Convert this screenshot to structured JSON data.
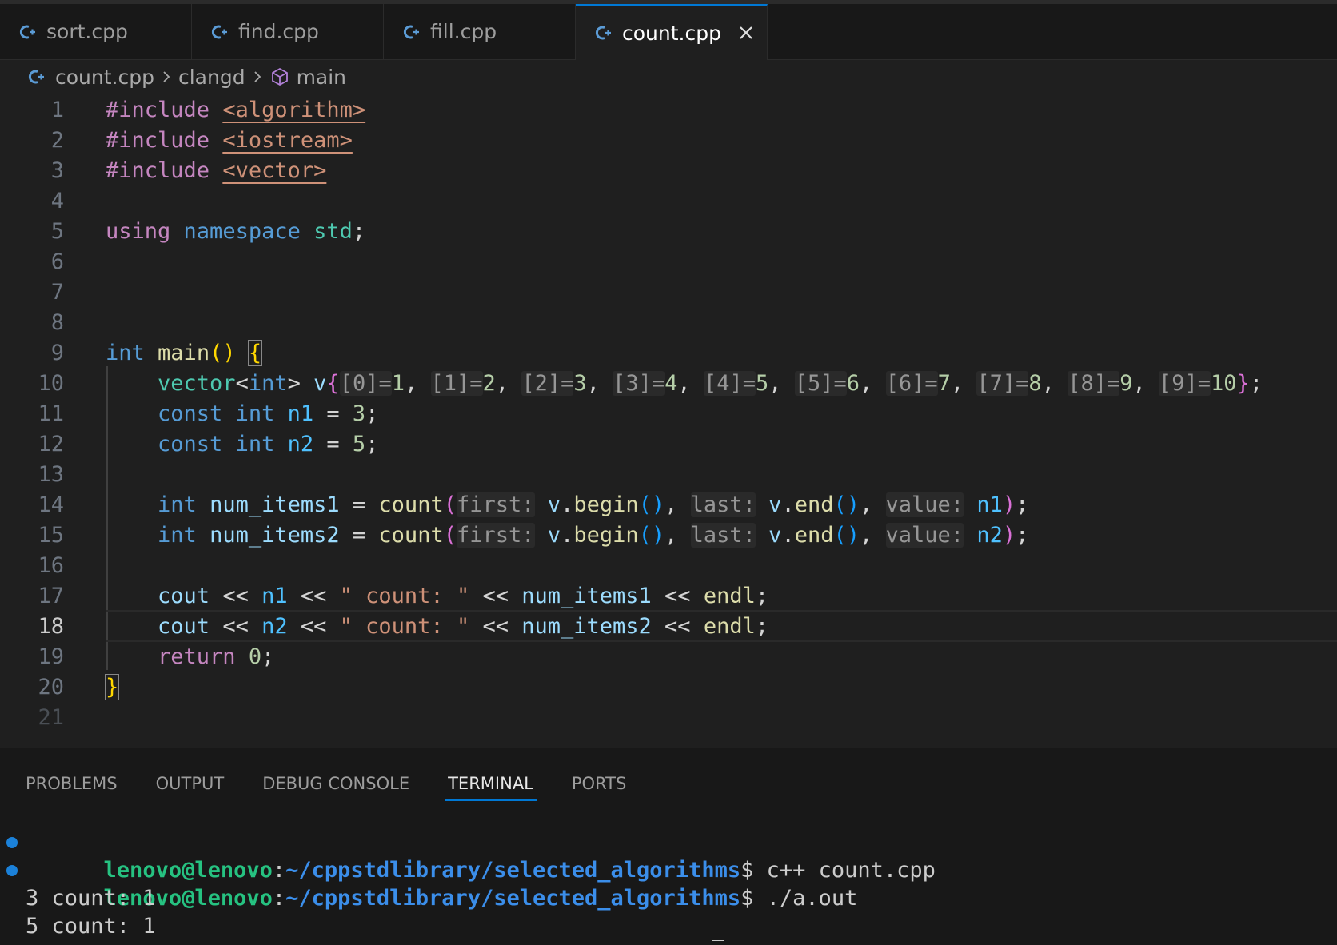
{
  "tabs": [
    {
      "label": "sort.cpp",
      "active": false
    },
    {
      "label": "find.cpp",
      "active": false
    },
    {
      "label": "fill.cpp",
      "active": false
    },
    {
      "label": "count.cpp",
      "active": true
    }
  ],
  "breadcrumb": {
    "file": "count.cpp",
    "scope": "clangd",
    "symbol": "main"
  },
  "editor": {
    "line_numbers": [
      "1",
      "2",
      "3",
      "4",
      "5",
      "6",
      "7",
      "8",
      "9",
      "10",
      "11",
      "12",
      "13",
      "14",
      "15",
      "16",
      "17",
      "18",
      "19",
      "20",
      "21"
    ],
    "current_line": "18",
    "include1": "<algorithm>",
    "include2": "<iostream>",
    "include3": "<vector>",
    "directive": "#include",
    "using": "using",
    "namespace": "namespace",
    "std": "std",
    "int": "int",
    "main": "main",
    "vector": "vector",
    "v": "v",
    "vals": [
      "1",
      "2",
      "3",
      "4",
      "5",
      "6",
      "7",
      "8",
      "9",
      "10"
    ],
    "hints_idx": [
      "[0]=",
      "[1]=",
      "[2]=",
      "[3]=",
      "[4]=",
      "[5]=",
      "[6]=",
      "[7]=",
      "[8]=",
      "[9]="
    ],
    "const": "const",
    "n1": "n1",
    "n2": "n2",
    "n1_val": "3",
    "n2_val": "5",
    "num_items1": "num_items1",
    "num_items2": "num_items2",
    "count": "count",
    "hint_first": "first:",
    "hint_last": "last:",
    "hint_value": "value:",
    "begin": "begin",
    "end": "end",
    "cout": "cout",
    "count_str": "\" count: \"",
    "endl": "endl",
    "return": "return",
    "zero": "0"
  },
  "panel": {
    "tabs": [
      "PROBLEMS",
      "OUTPUT",
      "DEBUG CONSOLE",
      "TERMINAL",
      "PORTS"
    ],
    "active_tab": "TERMINAL"
  },
  "terminal": {
    "user": "lenovo@lenovo",
    "path": "~/cppstdlibrary/selected_algorithms",
    "cmd1": "$ c++ count.cpp",
    "cmd2": "$ ./a.out",
    "out1": "3 count: 1",
    "out2": "5 count: 1"
  },
  "icons": {
    "file_icon": "cpp-file-icon",
    "close": "close-icon",
    "symbol": "cube-icon",
    "chevron": "chevron-right-icon"
  },
  "colors": {
    "accent": "#0078d4",
    "keyword": "#c586c0",
    "type": "#569cd6",
    "function": "#dcdcaa",
    "string": "#ce9178",
    "number": "#b5cea8"
  }
}
